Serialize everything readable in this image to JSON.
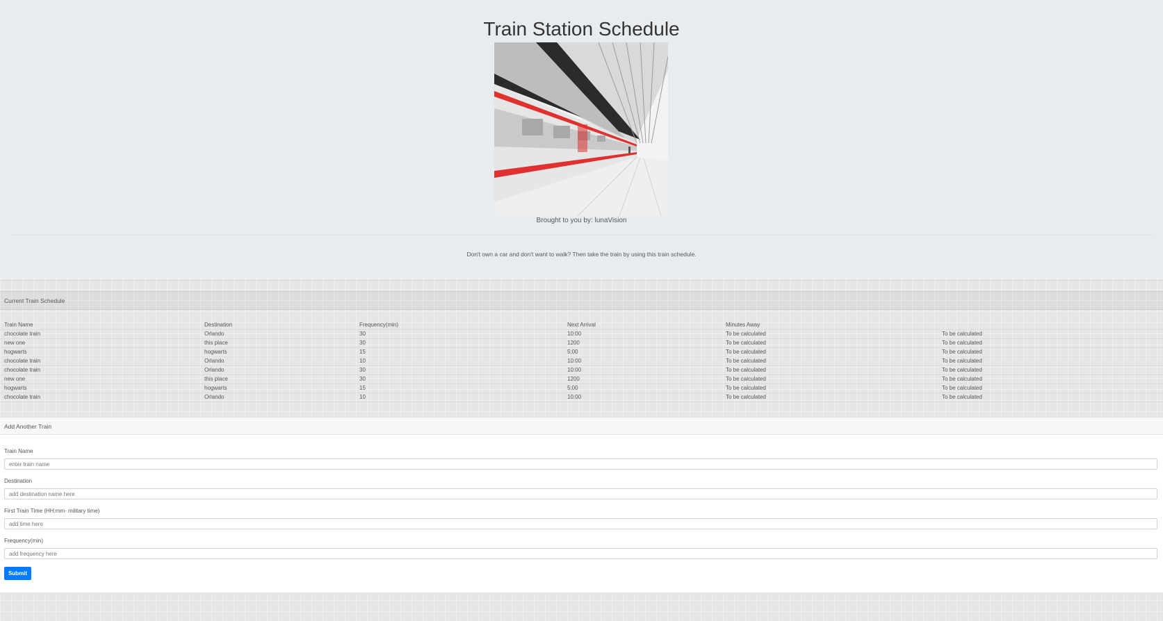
{
  "header": {
    "title": "Train Station Schedule",
    "credit": "Brought to you by: lunaVision",
    "lead": "Don't own a car and don't want to walk? Then take the train by using this train schedule."
  },
  "schedule": {
    "title": "Current Train Schedule",
    "columns": [
      "Train Name",
      "Destination",
      "Frequency(min)",
      "Next Arrival",
      "Minutes Away"
    ],
    "rows": [
      [
        "chocolate train",
        "Orlando",
        "30",
        "10:00",
        "To be calculated",
        "To be calculated"
      ],
      [
        "new one",
        "this place",
        "30",
        "1200",
        "To be calculated",
        "To be calculated"
      ],
      [
        "hogwarts",
        "hogwarts",
        "15",
        "5:00",
        "To be calculated",
        "To be calculated"
      ],
      [
        "chocolate train",
        "Orlando",
        "10",
        "10:00",
        "To be calculated",
        "To be calculated"
      ],
      [
        "chocolate train",
        "Orlando",
        "30",
        "10:00",
        "To be calculated",
        "To be calculated"
      ],
      [
        "new one",
        "this place",
        "30",
        "1200",
        "To be calculated",
        "To be calculated"
      ],
      [
        "hogwarts",
        "hogwarts",
        "15",
        "5:00",
        "To be calculated",
        "To be calculated"
      ],
      [
        "chocolate train",
        "Orlando",
        "10",
        "10:00",
        "To be calculated",
        "To be calculated"
      ]
    ]
  },
  "form": {
    "title": "Add Another Train",
    "train_name": {
      "label": "Train Name",
      "placeholder": "enter train name",
      "value": ""
    },
    "destination": {
      "label": "Destination",
      "placeholder": "add destination name here",
      "value": ""
    },
    "first_time": {
      "label": "First Train Time (HH:mm- military time)",
      "placeholder": "add time here",
      "value": ""
    },
    "frequency": {
      "label": "Frequency(min)",
      "placeholder": "add frequency here",
      "value": ""
    },
    "submit_label": "Submit"
  },
  "colors": {
    "primary": "#007bff",
    "train_stripe": "#e03131"
  }
}
